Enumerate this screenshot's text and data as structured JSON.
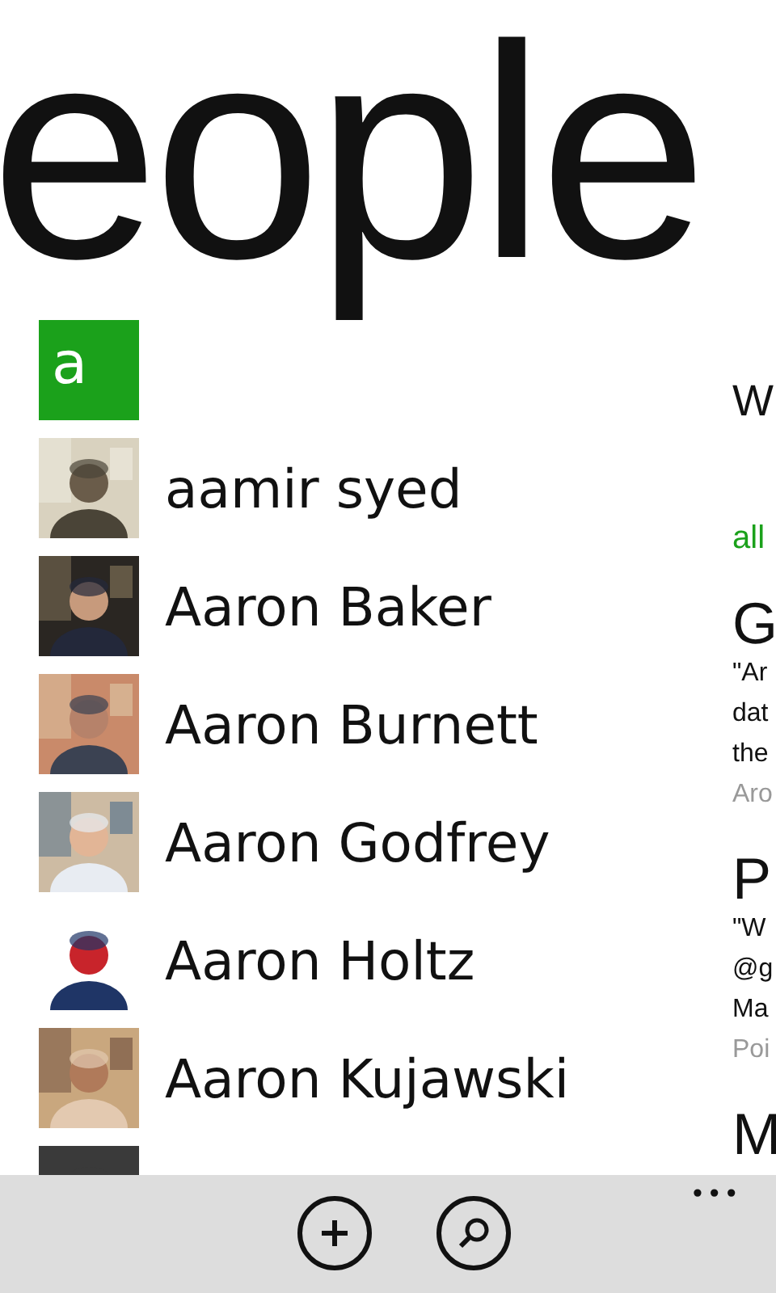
{
  "title": "eople",
  "group_tile": "a",
  "contacts": [
    {
      "name": "aamir syed",
      "avatar": {
        "kind": "picture"
      }
    },
    {
      "name": "Aaron Baker",
      "avatar": {
        "kind": "picture"
      }
    },
    {
      "name": "Aaron Burnett",
      "avatar": {
        "kind": "picture"
      }
    },
    {
      "name": "Aaron Godfrey",
      "avatar": {
        "kind": "picture"
      }
    },
    {
      "name": "Aaron Holtz",
      "avatar": {
        "kind": "picture"
      }
    },
    {
      "name": "Aaron Kujawski",
      "avatar": {
        "kind": "picture"
      }
    },
    {
      "avatar": {
        "kind": "picture"
      }
    }
  ],
  "whats_new": {
    "heading": "W",
    "filter": "all",
    "items": [
      {
        "author": "G",
        "lines": [
          "\"Ar",
          "dat",
          "the"
        ],
        "source": "Aro"
      },
      {
        "author": "P",
        "lines": [
          "\"W",
          "@g",
          "Ma"
        ],
        "source": "Poi"
      },
      {
        "author": "M"
      }
    ]
  },
  "app_bar": {
    "buttons": [
      {
        "kind": "add"
      },
      {
        "kind": "search"
      }
    ],
    "more": "•••"
  }
}
